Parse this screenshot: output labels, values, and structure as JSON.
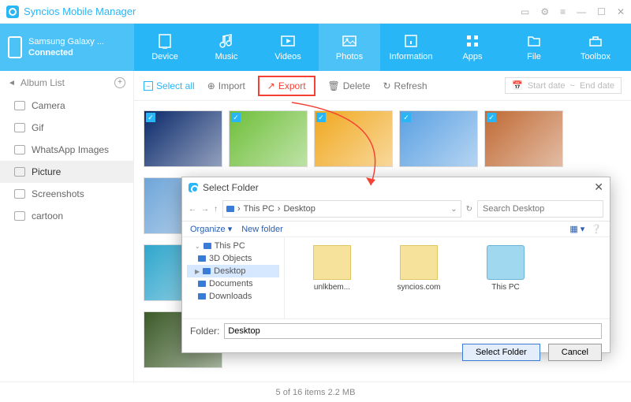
{
  "app": {
    "title": "Syncios Mobile Manager"
  },
  "device": {
    "name": "Samsung Galaxy ...",
    "status": "Connected"
  },
  "nav": [
    {
      "id": "device",
      "label": "Device"
    },
    {
      "id": "music",
      "label": "Music"
    },
    {
      "id": "videos",
      "label": "Videos"
    },
    {
      "id": "photos",
      "label": "Photos",
      "active": true
    },
    {
      "id": "information",
      "label": "Information"
    },
    {
      "id": "apps",
      "label": "Apps"
    },
    {
      "id": "file",
      "label": "File"
    },
    {
      "id": "toolbox",
      "label": "Toolbox"
    }
  ],
  "sidebar": {
    "head": "Album List",
    "items": [
      "Camera",
      "Gif",
      "WhatsApp Images",
      "Picture",
      "Screenshots",
      "cartoon"
    ],
    "active": "Picture"
  },
  "toolbar": {
    "selectall": "Select all",
    "import": "Import",
    "export": "Export",
    "delete": "Delete",
    "refresh": "Refresh",
    "start_date": "Start date",
    "end_date": "End date"
  },
  "status": "5 of 16 items 2.2 MB",
  "photo_colors": [
    "#0b2a6b",
    "#6fbf3a",
    "#f0a81f",
    "#5aa0e2",
    "#c06a34",
    "#6fa5d8",
    "#a9a070",
    "#5bd3f0",
    "#5b9f4a",
    "#dce6cd",
    "#2fa6cc",
    "#0e3b4a",
    "#4a6b2e",
    "#7a5c4a",
    "#c9a13c",
    "#3c5a28"
  ],
  "dialog": {
    "title": "Select Folder",
    "crumb1": "This PC",
    "crumb2": "Desktop",
    "search_ph": "Search Desktop",
    "organize": "Organize",
    "newfolder": "New folder",
    "tree": [
      "This PC",
      "3D Objects",
      "Desktop",
      "Documents",
      "Downloads"
    ],
    "tree_sel": "Desktop",
    "files": [
      {
        "name": "unlkbem...",
        "kind": "folder"
      },
      {
        "name": "syncios.com",
        "kind": "folder"
      },
      {
        "name": "This PC",
        "kind": "pc"
      }
    ],
    "folder_lbl": "Folder:",
    "folder_val": "Desktop",
    "select": "Select Folder",
    "cancel": "Cancel"
  }
}
